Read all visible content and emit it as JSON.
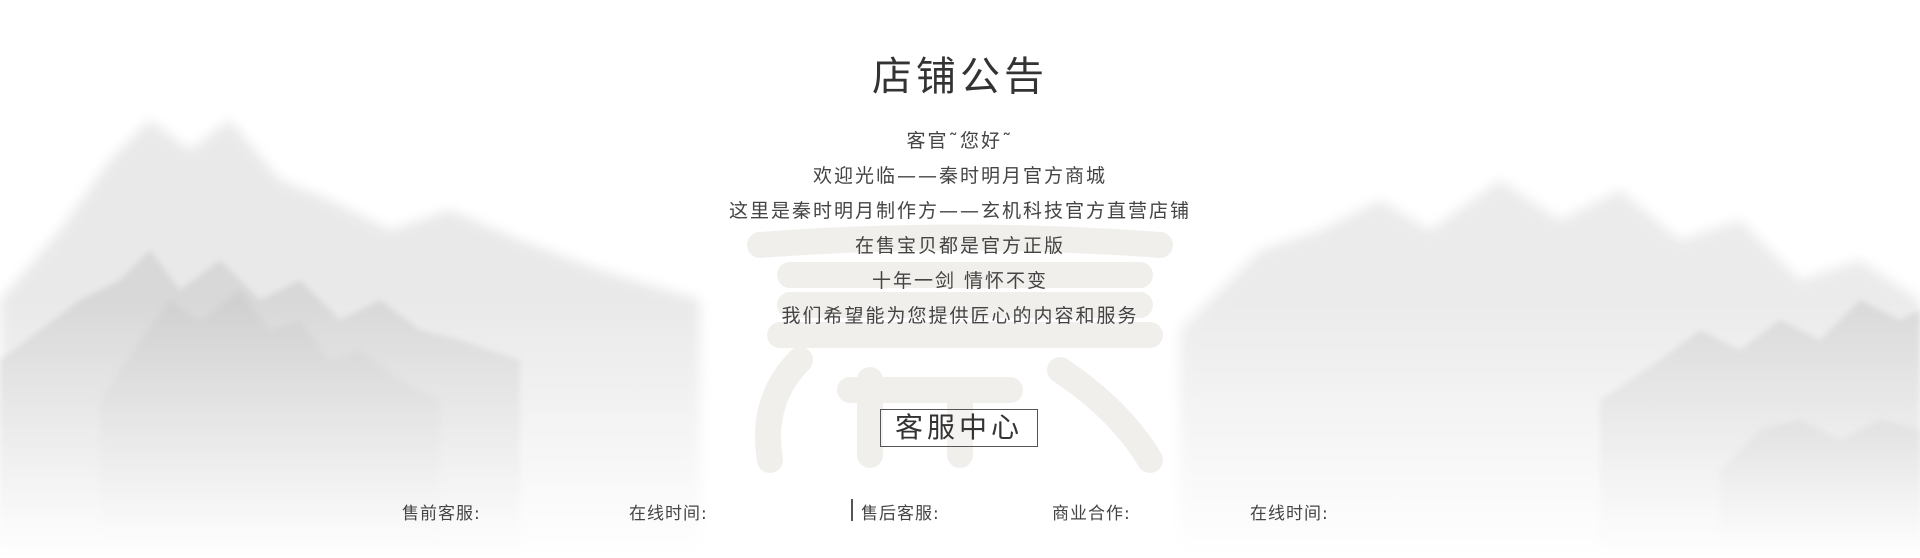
{
  "title": "店铺公告",
  "notice_lines": [
    "客官˜您好˜",
    "欢迎光临——秦时明月官方商城",
    "这里是秦时明月制作方——玄机科技官方直营店铺",
    "在售宝贝都是官方正版",
    "十年一剑 情怀不变",
    "我们希望能为您提供匠心的内容和服务"
  ],
  "service_center_label": "客服中心",
  "footer": {
    "presale": "售前客服:",
    "online_time_1": "在线时间:",
    "aftersale": "售后客服:",
    "business": "商业合作:",
    "online_time_2": "在线时间:"
  },
  "colors": {
    "text": "#333333",
    "mountain_ink": "#c9c9c9",
    "watermark": "#f1efec"
  },
  "icons": {
    "backdrop": "ink-mountains-illustration",
    "watermark": "qin-seal-watermark"
  }
}
